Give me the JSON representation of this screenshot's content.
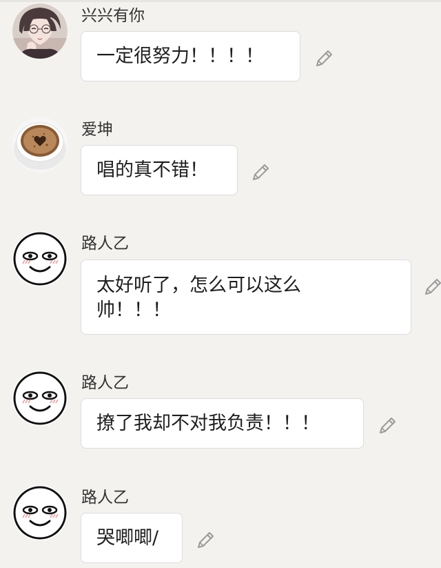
{
  "messages": [
    {
      "name": "兴兴有你",
      "lines": [
        "一定很努力！！！！"
      ],
      "avatar": "portrait-avatar"
    },
    {
      "name": "爱坤",
      "lines": [
        "唱的真不错！"
      ],
      "avatar": "coffee-avatar"
    },
    {
      "name": "路人乙",
      "lines": [
        "太好听了，怎么可以这么",
        "帅！！！"
      ],
      "avatar": "smiley-avatar"
    },
    {
      "name": "路人乙",
      "lines": [
        "撩了我却不对我负责！！！"
      ],
      "avatar": "smiley-avatar"
    },
    {
      "name": "路人乙",
      "lines": [
        "哭唧唧/"
      ],
      "avatar": "smiley-avatar"
    }
  ],
  "icons": {
    "edit": "pencil-icon"
  },
  "colors": {
    "background": "#f3f2ef",
    "bubble": "#ffffff",
    "bubble_border": "#dcdcdc",
    "name_text": "#333333",
    "message_text": "#1e1e1e",
    "pencil": "#9a9a9a",
    "blush": "#ee9a9a"
  }
}
